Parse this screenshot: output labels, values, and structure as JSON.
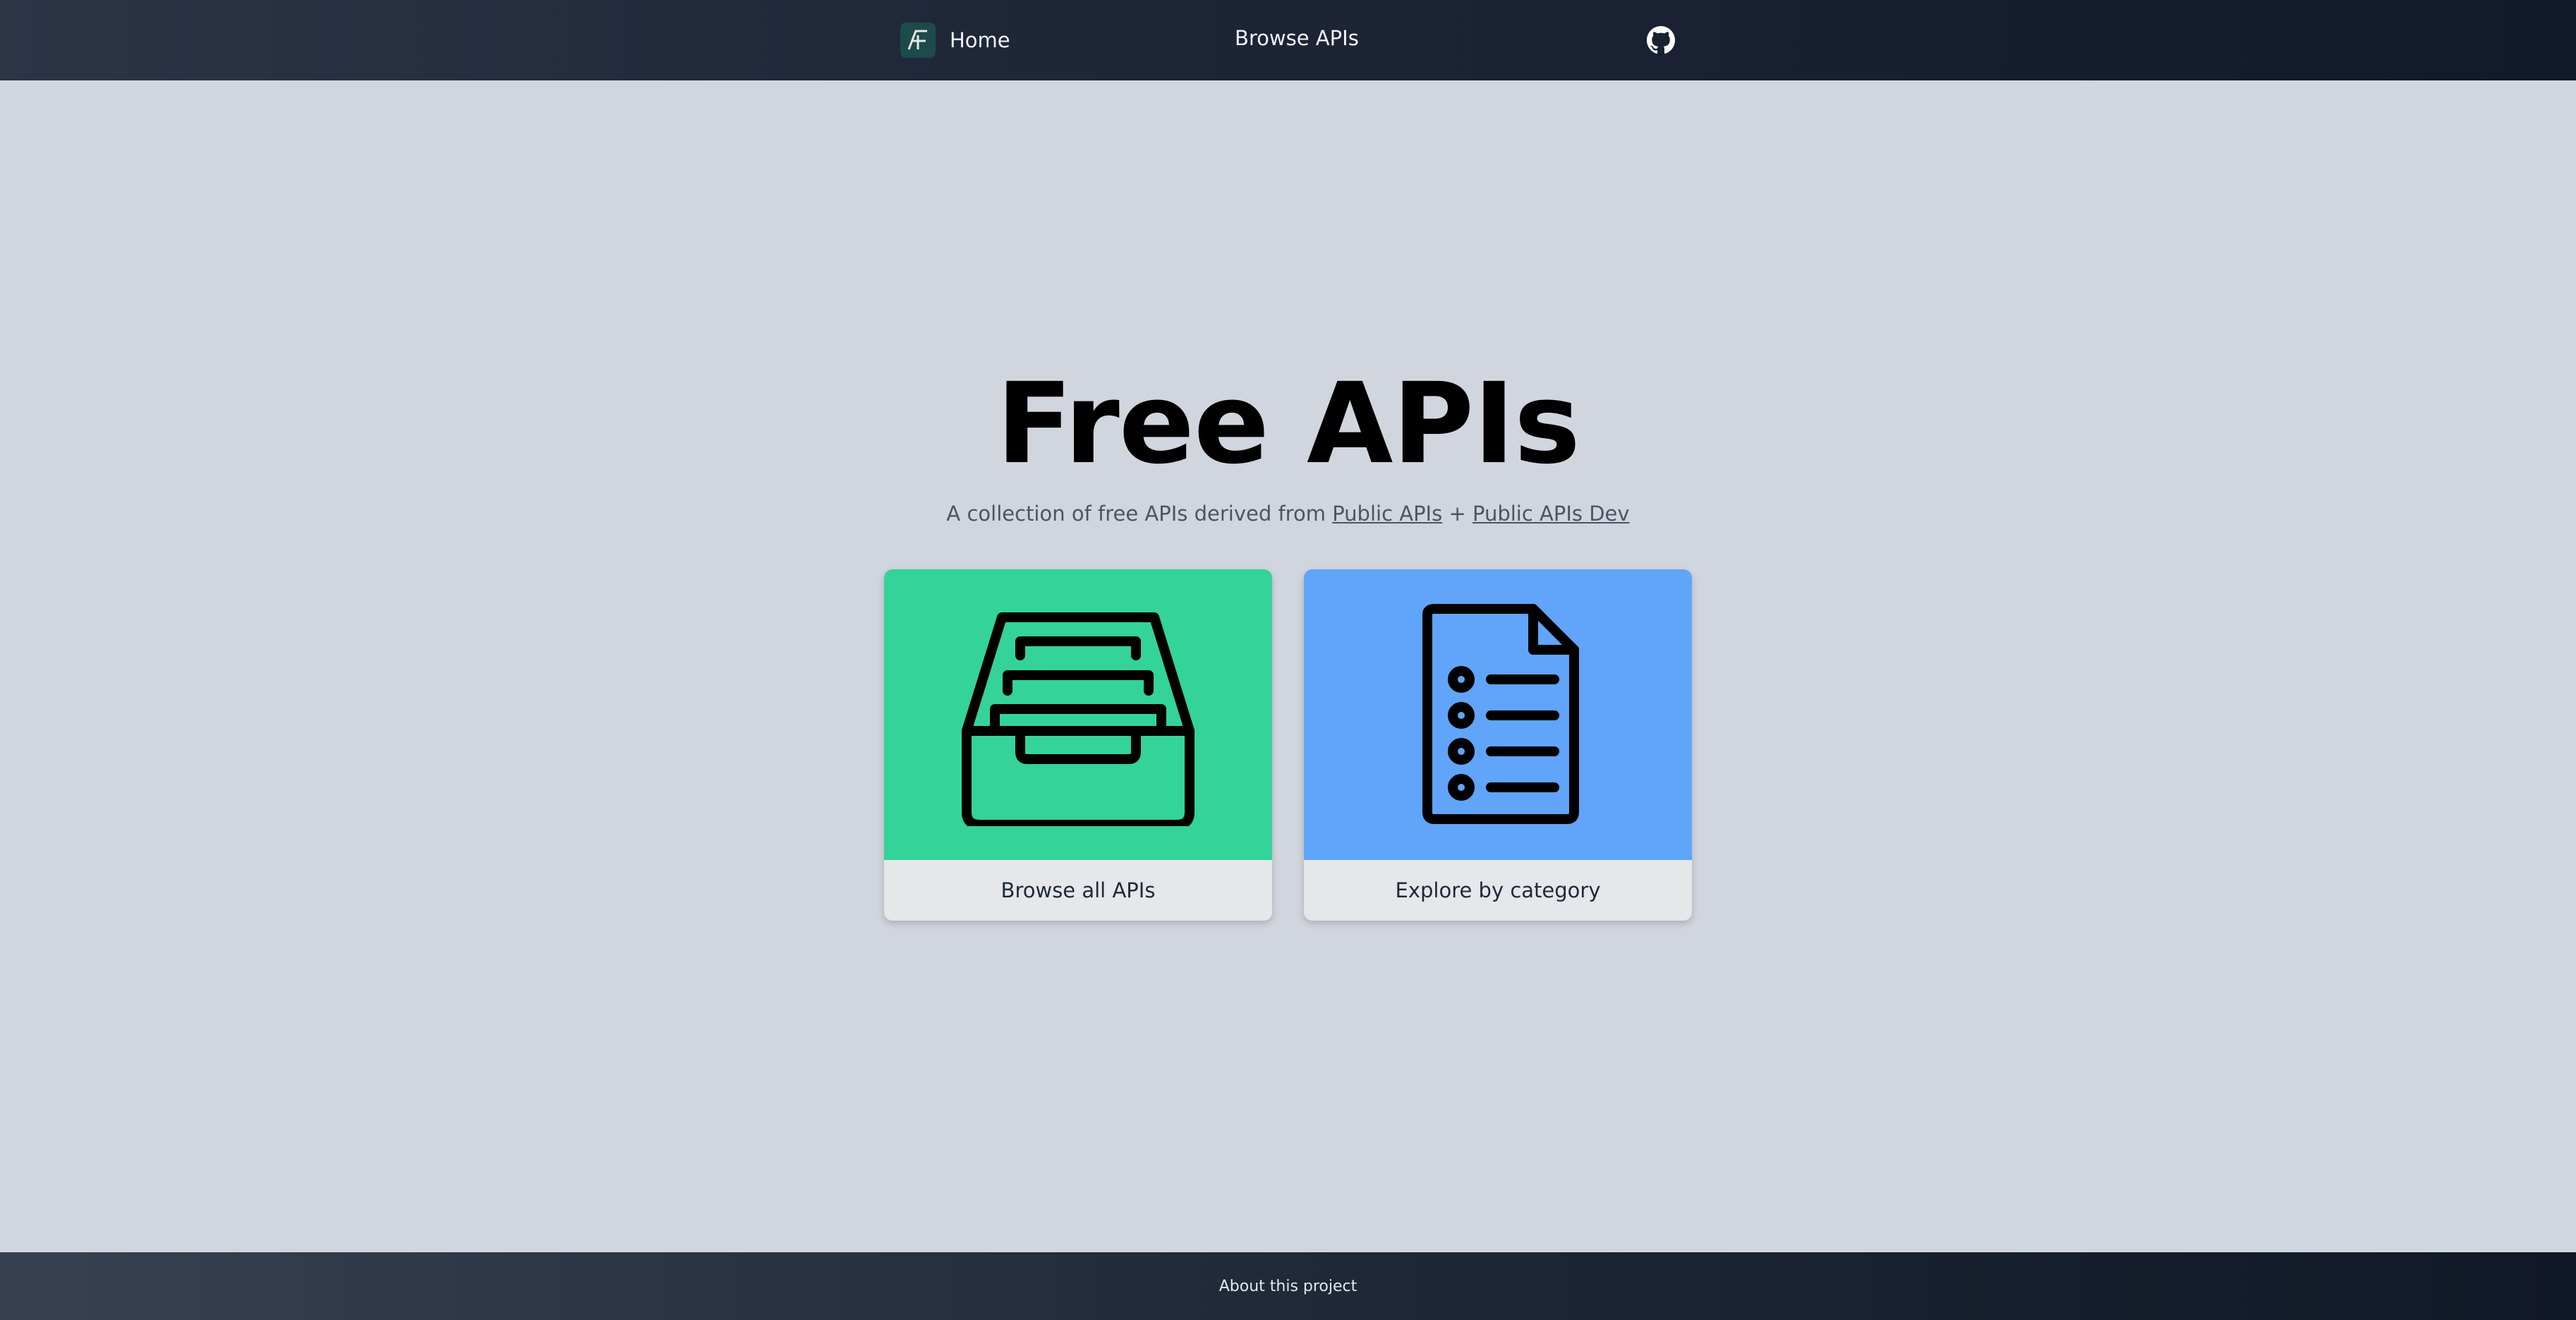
{
  "nav": {
    "logo_icon": "free-apis-logo-icon",
    "home_label": "Home",
    "browse_label": "Browse APIs",
    "github_icon": "github-icon"
  },
  "hero": {
    "title": "Free APIs",
    "subtitle_prefix": "A collection of free APIs derived from",
    "link_public_apis": "Public APIs",
    "separator": "+",
    "link_public_apis_dev": "Public APIs Dev"
  },
  "cards": [
    {
      "label": "Browse all APIs",
      "icon": "archive-inbox-icon",
      "color": "#34d399"
    },
    {
      "label": "Explore by category",
      "icon": "document-list-icon",
      "color": "#60a5fa"
    }
  ],
  "footer": {
    "about_label": "About this project"
  },
  "colors": {
    "page_bg": "#d1d5de",
    "nav_bg": "#1e2738",
    "accent_green": "#34d399",
    "accent_blue": "#60a5fa"
  }
}
